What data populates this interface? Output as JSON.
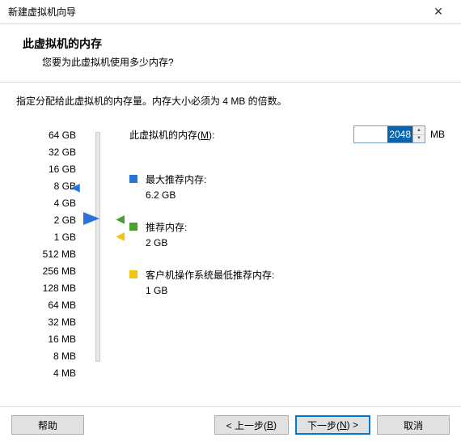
{
  "window": {
    "title": "新建虚拟机向导",
    "close": "✕"
  },
  "header": {
    "title": "此虚拟机的内存",
    "subtitle": "您要为此虚拟机使用多少内存?"
  },
  "instruction": "指定分配给此虚拟机的内存量。内存大小必须为 4 MB 的倍数。",
  "scale": [
    "64 GB",
    "32 GB",
    "16 GB",
    "8 GB",
    "4 GB",
    "2 GB",
    "1 GB",
    "512 MB",
    "256 MB",
    "128 MB",
    "64 MB",
    "32 MB",
    "16 MB",
    "8 MB",
    "4 MB"
  ],
  "memory": {
    "label_prefix": "此虚拟机的内存(",
    "hotkey": "M",
    "label_suffix": "):",
    "value": "2048",
    "unit": "MB"
  },
  "legend": {
    "max": {
      "label": "最大推荐内存:",
      "value": "6.2 GB"
    },
    "rec": {
      "label": "推荐内存:",
      "value": "2 GB"
    },
    "min": {
      "label": "客户机操作系统最低推荐内存:",
      "value": "1 GB"
    }
  },
  "footer": {
    "help": "帮助",
    "back_prefix": "< 上一步(",
    "back_key": "B",
    "back_suffix": ")",
    "next_prefix": "下一步(",
    "next_key": "N",
    "next_suffix": ") >",
    "cancel": "取消"
  }
}
